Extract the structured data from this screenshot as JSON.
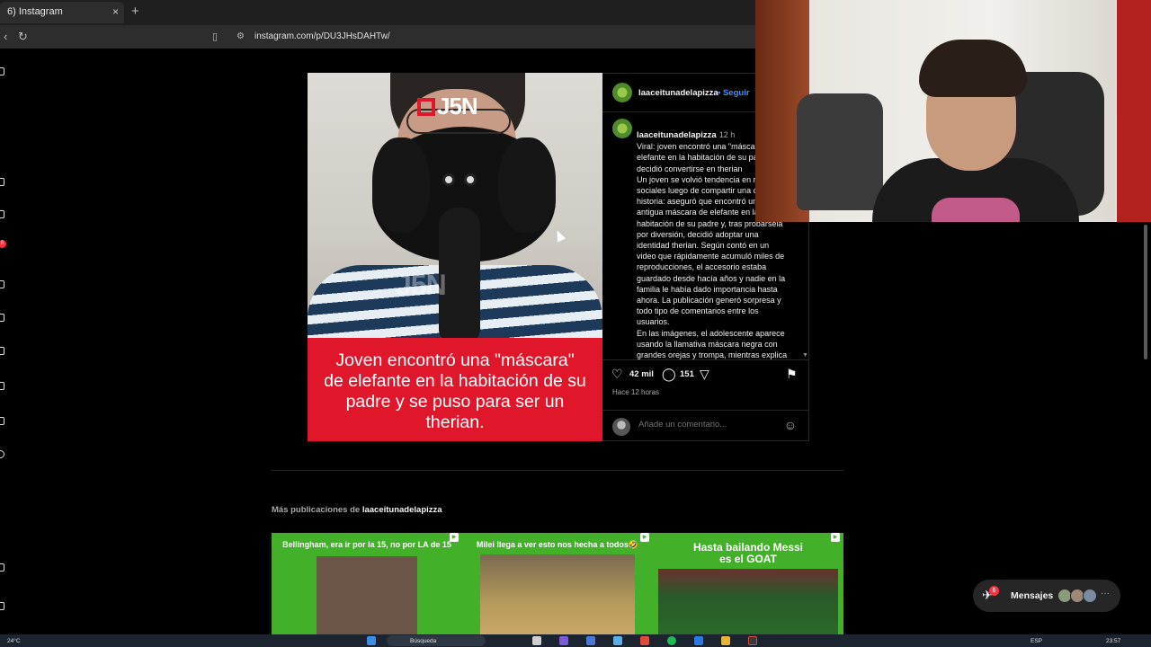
{
  "browser": {
    "tab_title": "6) Instagram",
    "tab_close": "×",
    "new_tab": "+",
    "url": "instagram.com/p/DU3JHsDAHTw/"
  },
  "left_rail": {
    "badge_count": "6"
  },
  "post": {
    "image_watermark": "J5N",
    "image_caption": "Joven encontró una \"máscara\" de elefante en la habitación de su padre y se puso para ser un therian.",
    "header_username": "laaceitunadelapizza",
    "follow_label": "• Seguir",
    "comment_username": "laaceitunadelapizza",
    "comment_time": "12 h",
    "description_paragraphs": [
      "Viral: joven encontró una \"máscara\" de elefante en la habitación de su padre y decidió convertirse en therian",
      "Un joven se volvió tendencia en redes sociales luego de compartir una curiosa historia: aseguró que encontró una antigua máscara de elefante en la habitación de su padre y, tras probársela por diversión, decidió adoptar una identidad therian. Según contó en un video que rápidamente acumuló miles de reproducciones, el accesorio estaba guardado desde hacía años y nadie en la familia le había dado importancia hasta ahora. La publicación generó sorpresa y todo tipo de comentarios entre los usuarios.",
      "En las imágenes, el adolescente aparece usando la llamativa máscara negra con grandes orejas y trompa, mientras explica que se sintió \"conectado\" al"
    ],
    "likes": "42 mil",
    "comments": "151",
    "posted_ago": "Hace 12 horas",
    "comment_placeholder": "Añade un comentario..."
  },
  "more_posts": {
    "label_prefix": "Más publicaciones de",
    "username": "laaceitunadelapizza",
    "items": [
      {
        "title": "Bellingham, era ir por la 15, no por LA de 15"
      },
      {
        "title": "Milei llega a ver esto nos hecha a todos🤣"
      },
      {
        "title": "Hasta bailando Messi es el GOAT"
      }
    ]
  },
  "messages": {
    "label": "Mensajes",
    "badge": "6"
  },
  "taskbar": {
    "weather": "24°C",
    "search": "Búsqueda",
    "language": "ESP",
    "time": "23:57"
  },
  "colors": {
    "instagram_blue": "#4c8ef7",
    "notification_red": "#ff3040",
    "j5n_red": "#e0162b",
    "thumb_green": "#43b02a"
  }
}
